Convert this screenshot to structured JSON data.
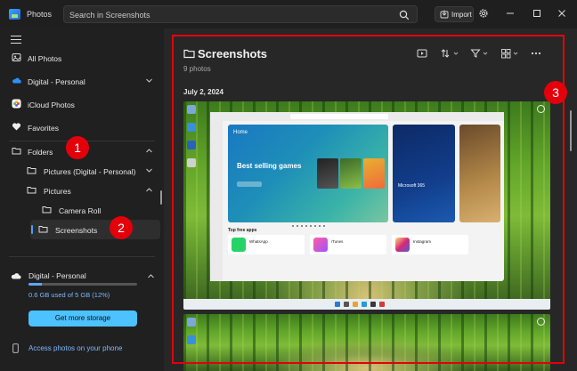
{
  "app": {
    "title": "Photos",
    "icon": "photos-app-icon"
  },
  "search": {
    "placeholder": "Search in Screenshots"
  },
  "toolbar": {
    "import_label": "Import"
  },
  "sidebar": {
    "items": [
      {
        "label": "All Photos",
        "icon": "all-photos-icon"
      },
      {
        "label": "Digital - Personal",
        "icon": "onedrive-cloud-icon",
        "chevron": "down"
      },
      {
        "label": "iCloud Photos",
        "icon": "icloud-icon"
      },
      {
        "label": "Favorites",
        "icon": "heart-icon"
      },
      {
        "label": "Folders",
        "icon": "folder-icon",
        "chevron": "up"
      },
      {
        "label": "Pictures (Digital - Personal)",
        "icon": "folder-icon",
        "chevron": "down"
      },
      {
        "label": "Pictures",
        "icon": "folder-icon",
        "chevron": "up"
      },
      {
        "label": "Camera Roll",
        "icon": "folder-icon"
      },
      {
        "label": "Screenshots",
        "icon": "folder-icon",
        "selected": true
      }
    ],
    "storage": {
      "title": "Digital - Personal",
      "used_text": "0.6 GB used of 5 GB (12%)",
      "used_fraction": 0.12,
      "button_label": "Get more storage"
    },
    "phone_link": "Access photos on your phone"
  },
  "main": {
    "title": "Screenshots",
    "count": "9 photos",
    "date": "July 2, 2024"
  },
  "screenshot": {
    "hero_home": "Home",
    "hero_title": "Best selling games",
    "hero2_title": "Microsoft 365",
    "free_apps_title": "Top free apps",
    "apps": [
      "WhatsApp",
      "iTunes",
      "Instagram"
    ]
  },
  "annotations": {
    "badge1": "1",
    "badge2": "2",
    "badge3": "3"
  },
  "colors": {
    "accent": "#4cc2ff",
    "annotation": "#e3000b",
    "link": "#7fb8ff"
  }
}
